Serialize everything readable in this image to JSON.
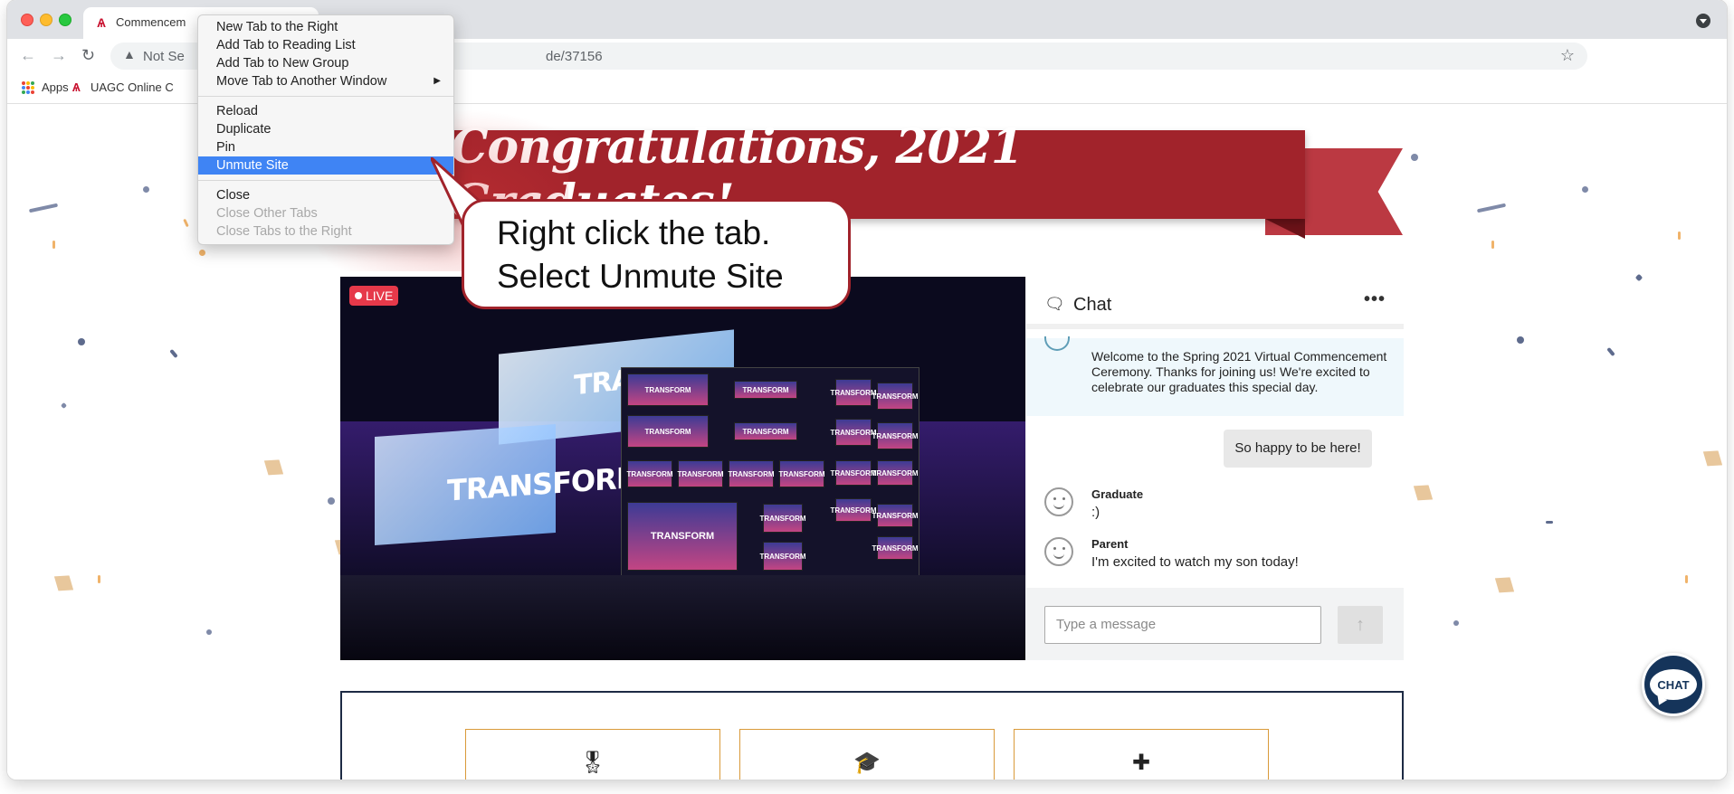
{
  "browser": {
    "tab_title": "Commencem",
    "address_warning": "Not Se",
    "address_url": "de/37156",
    "bookmarks": [
      {
        "label": "Apps"
      },
      {
        "label": "UAGC Online C"
      }
    ]
  },
  "context_menu": {
    "items": [
      {
        "label": "New Tab to the Right",
        "state": "normal"
      },
      {
        "label": "Add Tab to Reading List",
        "state": "normal"
      },
      {
        "label": "Add Tab to New Group",
        "state": "normal"
      },
      {
        "label": "Move Tab to Another Window",
        "state": "normal",
        "submenu": "▶"
      },
      {
        "label": "Reload",
        "state": "normal"
      },
      {
        "label": "Duplicate",
        "state": "normal"
      },
      {
        "label": "Pin",
        "state": "normal"
      },
      {
        "label": "Unmute Site",
        "state": "selected"
      },
      {
        "label": "Close",
        "state": "normal"
      },
      {
        "label": "Close Other Tabs",
        "state": "disabled"
      },
      {
        "label": "Close Tabs to the Right",
        "state": "disabled"
      }
    ]
  },
  "callout": {
    "line1": "Right click the tab.",
    "line2": "Select Unmute Site"
  },
  "banner": {
    "title": "Congratulations, 2021 Graduates!"
  },
  "video": {
    "live_label": "LIVE",
    "wall_text": "TRANSFORM",
    "screen_text_left": "TRANSFORM",
    "screen_text_top": "TRA"
  },
  "chat": {
    "title": "Chat",
    "more_label": "•••",
    "system_message": "Welcome to the Spring 2021 Virtual Commencement Ceremony. Thanks for joining us! We're excited to celebrate our graduates this special day.",
    "my_message": "So happy to be here!",
    "messages": [
      {
        "author": "Graduate",
        "text": ":)"
      },
      {
        "author": "Parent",
        "text": "I'm excited to watch my son today!"
      }
    ],
    "input_placeholder": "Type a message",
    "send_icon": "↑"
  },
  "chat_fab": {
    "label": "CHAT"
  },
  "cards": [
    {
      "icon": "award-icon",
      "glyph": "🎖"
    },
    {
      "icon": "graduation-cap-icon",
      "glyph": "🎓"
    },
    {
      "icon": "plus-icon",
      "glyph": "✚"
    }
  ],
  "colors": {
    "banner_red": "#a1232b",
    "menu_highlight": "#3f84f4",
    "chat_fab_navy": "#15345a",
    "card_border": "#d99a3a"
  }
}
